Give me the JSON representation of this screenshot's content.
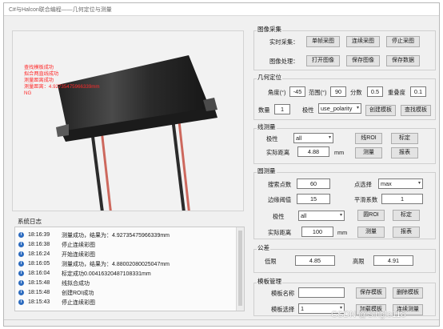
{
  "window": {
    "title": "C#与Halcon联合编程——几何定位与测量"
  },
  "viewer": {
    "overlay_lines": [
      "查找模板成功",
      "拟合两直线成功",
      "测量距离成功",
      "测量距离：4.92735475966339mm",
      "NG"
    ]
  },
  "log": {
    "label": "系统日志",
    "entries": [
      {
        "time": "18:16:39",
        "message": "测量成功，结果为：4.92735475966339mm"
      },
      {
        "time": "18:16:38",
        "message": "停止连续彩图"
      },
      {
        "time": "18:16:24",
        "message": "开始连续彩图"
      },
      {
        "time": "18:16:05",
        "message": "测量成功，结果为：4.88002080025047mm"
      },
      {
        "time": "18:16:04",
        "message": "标定成功0.00416320487108331mm"
      },
      {
        "time": "18:15:48",
        "message": "线拟合成功"
      },
      {
        "time": "18:15:48",
        "message": "创建ROI成功"
      },
      {
        "time": "18:15:43",
        "message": "停止连续彩图"
      }
    ]
  },
  "acquisition": {
    "title": "图像采集",
    "live_label": "实时采集：",
    "single_button": "单帧采图",
    "continuous_button": "连续采图",
    "stop_button": "停止采图",
    "process_label": "图像处理：",
    "open_button": "打开图像",
    "save_image_button": "保存图像",
    "save_data_button": "保存数据"
  },
  "geometry": {
    "title": "几何定位",
    "angle_label": "角度(°)",
    "angle_value": "-45",
    "range_label": "范围(°)",
    "range_value": "90",
    "score_label": "分数",
    "score_value": "0.5",
    "overlap_label": "重叠度",
    "overlap_value": "0.1",
    "count_label": "数量",
    "count_value": "1",
    "polarity_label": "极性",
    "polarity_value": "use_polarity",
    "create_button": "创建模板",
    "find_button": "查找模板"
  },
  "line_measure": {
    "title": "线测量",
    "polarity_label": "极性",
    "polarity_value": "all",
    "roi_button": "线ROI",
    "calibrate_button": "标定",
    "distance_label": "实际距离",
    "distance_value": "4.88",
    "unit": "mm",
    "measure_button": "测量",
    "report_button": "报表"
  },
  "circle_measure": {
    "title": "圆测量",
    "search_points_label": "搜索点数",
    "search_points_value": "60",
    "point_select_label": "点选择",
    "point_select_value": "max",
    "edge_threshold_label": "边缘阈值",
    "edge_threshold_value": "15",
    "smooth_label": "平滑系数",
    "smooth_value": "1",
    "polarity_label": "极性",
    "polarity_value": "all",
    "roi_button": "圆ROI",
    "calibrate_button": "标定",
    "distance_label": "实际距离",
    "distance_value": "100",
    "unit": "mm",
    "measure_button": "测量",
    "report_button": "报表"
  },
  "tolerance": {
    "title": "公差",
    "lower_label": "低限",
    "lower_value": "4.85",
    "upper_label": "高限",
    "upper_value": "4.91"
  },
  "template_mgmt": {
    "title": "模板管理",
    "name_label": "模板名称",
    "name_value": "",
    "save_button": "保存模板",
    "delete_button": "删除模板",
    "select_label": "模板选择",
    "select_value": "1",
    "load_button": "加载模板",
    "continuous_button": "连续测量"
  },
  "watermark": "CSDN @Single118",
  "colors": {
    "overlay_text": "#ff2a2a",
    "info_icon": "#2d6cc0"
  }
}
